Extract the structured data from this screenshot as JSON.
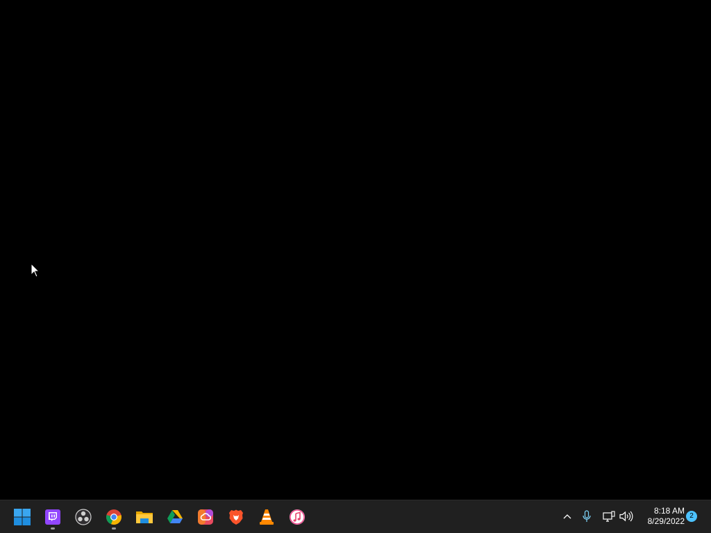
{
  "taskbar": {
    "apps": [
      {
        "name": "start-button",
        "icon": "windows-logo-icon",
        "running": false
      },
      {
        "name": "twitch-app",
        "icon": "twitch-icon",
        "running": true
      },
      {
        "name": "obs-app",
        "icon": "obs-icon",
        "running": false
      },
      {
        "name": "chrome-app",
        "icon": "chrome-icon",
        "running": true
      },
      {
        "name": "file-explorer-app",
        "icon": "folder-icon",
        "running": false
      },
      {
        "name": "google-drive-app",
        "icon": "google-drive-icon",
        "running": false
      },
      {
        "name": "creative-cloud-app",
        "icon": "creative-cloud-icon",
        "running": false
      },
      {
        "name": "brave-app",
        "icon": "brave-lion-icon",
        "running": false
      },
      {
        "name": "vlc-app",
        "icon": "vlc-cone-icon",
        "running": false
      },
      {
        "name": "itunes-app",
        "icon": "itunes-music-icon",
        "running": false
      }
    ],
    "tray": {
      "icons": [
        "chevron-up-icon",
        "microphone-icon",
        "network-icon",
        "volume-icon"
      ],
      "time": "8:18 AM",
      "date": "8/29/2022",
      "notification_count": "2"
    }
  },
  "colors": {
    "desktop": "#000000",
    "taskbar": "#202020",
    "accent": "#4cc2ff"
  }
}
